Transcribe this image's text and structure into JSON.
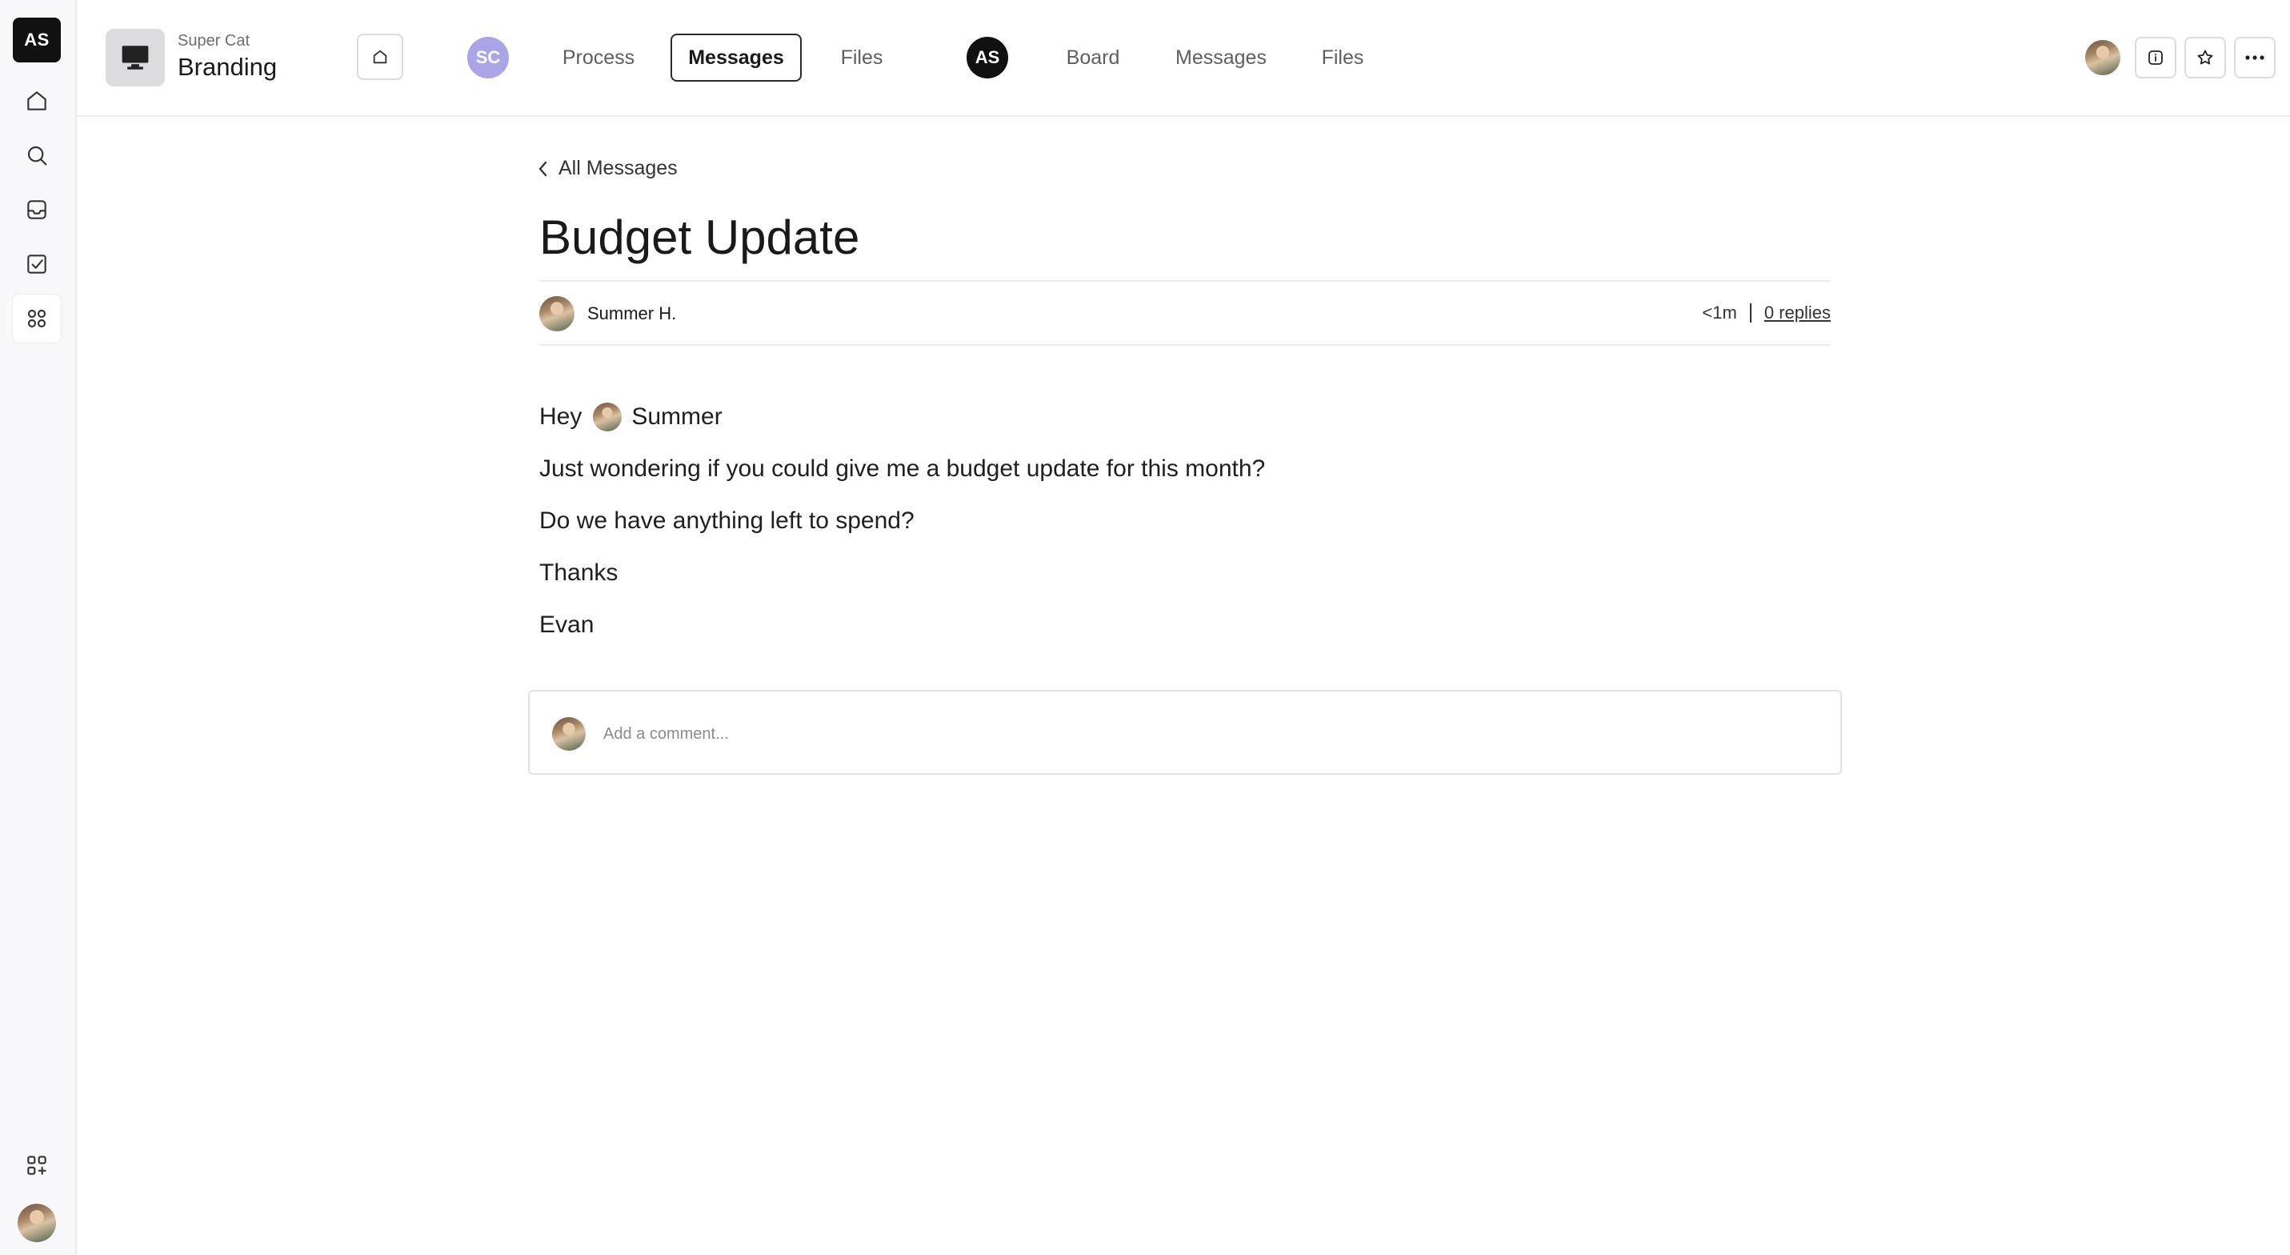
{
  "workspace": {
    "badge": "AS"
  },
  "rail": {
    "items": [
      "home",
      "search",
      "inbox",
      "tasks",
      "apps"
    ],
    "active": "apps",
    "bottom": [
      "add-apps",
      "profile"
    ]
  },
  "project": {
    "org": "Super Cat",
    "name": "Branding"
  },
  "nav": {
    "groups": [
      {
        "badge": "SC",
        "badge_color": "#a9a5e6",
        "tabs": [
          "Process",
          "Messages",
          "Files"
        ],
        "selected": "Messages"
      },
      {
        "badge": "AS",
        "badge_color": "#111111",
        "tabs": [
          "Board",
          "Messages",
          "Files"
        ]
      }
    ]
  },
  "breadcrumb": {
    "back_label": "All Messages"
  },
  "message": {
    "title": "Budget Update",
    "author": "Summer H.",
    "time": "<1m",
    "replies": "0 replies",
    "lines": {
      "greeting": "Hey",
      "mention": "Summer",
      "l1": "Just wondering if you could give me a budget update for this month?",
      "l2": "Do we have anything left to spend?",
      "l3": "Thanks",
      "l4": "Evan"
    }
  },
  "comment": {
    "placeholder": "Add a comment..."
  }
}
